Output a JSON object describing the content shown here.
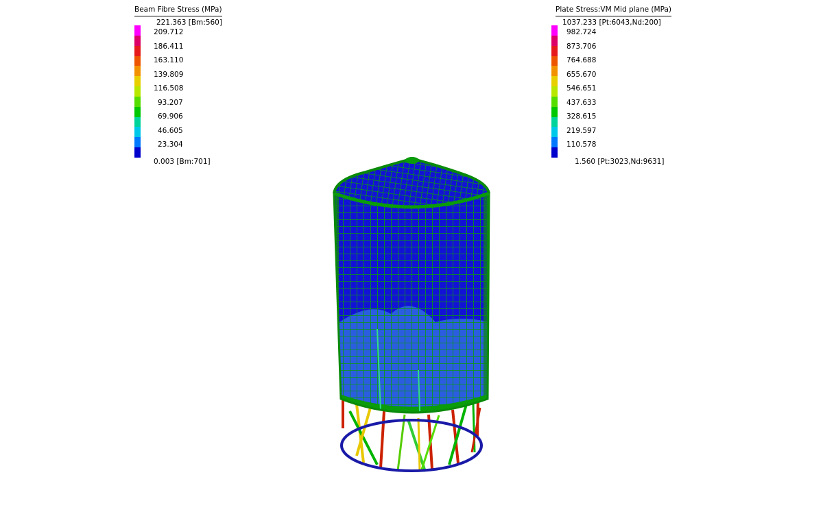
{
  "beam_legend": {
    "title": "Beam Fibre Stress  (MPa)",
    "max_label": "221.363 [Bm:560]",
    "min_label": "0.003 [Bm:701]",
    "ticks": [
      "209.712",
      "186.411",
      "163.110",
      "139.809",
      "116.508",
      "93.207",
      "69.906",
      "46.605",
      "23.304"
    ]
  },
  "plate_legend": {
    "title": "Plate Stress:VM Mid plane  (MPa)",
    "max_label": "1037.233 [Pt:6043,Nd:200]",
    "min_label": "1.560 [Pt:3023,Nd:9631]",
    "ticks": [
      "982.724",
      "873.706",
      "764.688",
      "655.670",
      "546.651",
      "437.633",
      "328.615",
      "219.597",
      "110.578"
    ]
  },
  "colors": {
    "scale": [
      "#ff00ff",
      "#dd0066",
      "#e61a1a",
      "#ee5500",
      "#f29200",
      "#e8d000",
      "#b8e800",
      "#55dd00",
      "#00c800",
      "#00d49a",
      "#00c8e8",
      "#0078ff",
      "#0000cc"
    ],
    "mesh_line": "#009a00",
    "shell_fill": "#1212d6",
    "shell_lower_fill": "#2a5de0",
    "ring": "#1a1aa8"
  }
}
